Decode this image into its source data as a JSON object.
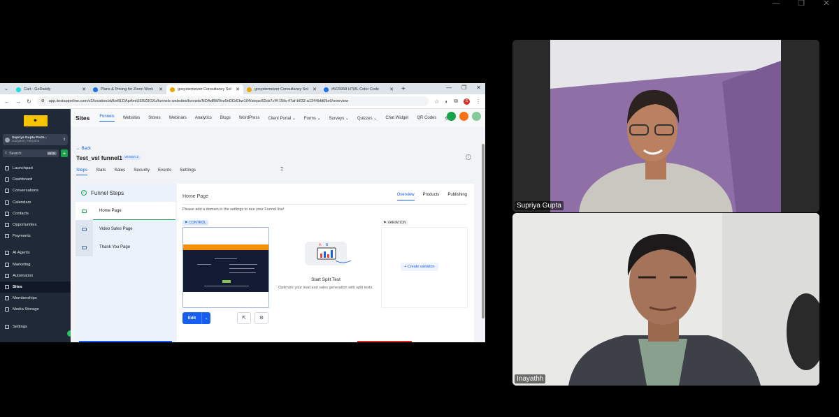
{
  "browser": {
    "tabs": [
      {
        "label": "Cart - GoDaddy",
        "icon": "godaddy-icon",
        "active": false
      },
      {
        "label": "Plans & Pricing for Zoom Work",
        "icon": "zoom-icon",
        "active": false
      },
      {
        "label": "gosystemeizer Consultancy Sol",
        "icon": "goosystemizer-icon",
        "active": true
      },
      {
        "label": "gosystemeizer Consultancy Sol",
        "icon": "goosystemizer-icon",
        "active": false
      },
      {
        "label": "#5C5958 HTML Color Code",
        "icon": "color-code-icon",
        "active": false
      }
    ],
    "url": "app.iinstapipeline.com/v2/location/aWzrBLDApAmiUEBZ0OZu/funnels-websites/funnels/NOAdBW9vz5nDGrEkw104/steps/62cb7cf4-15fa-47af-b632-a1344bfd69e9/overview",
    "profile_initial": "S"
  },
  "sidebar": {
    "account_name": "Supriya Gupta Profe...",
    "account_location": "Gurgaon, Haryana",
    "search_placeholder": "Search",
    "search_kbd": "ctrl K",
    "nav": [
      {
        "label": "Launchpad",
        "icon": "rocket-icon"
      },
      {
        "label": "Dashboard",
        "icon": "dashboard-icon"
      },
      {
        "label": "Conversations",
        "icon": "chat-icon"
      },
      {
        "label": "Calendars",
        "icon": "calendar-icon"
      },
      {
        "label": "Contacts",
        "icon": "contacts-icon"
      },
      {
        "label": "Opportunities",
        "icon": "opportunities-icon"
      },
      {
        "label": "Payments",
        "icon": "payments-icon"
      }
    ],
    "nav2": [
      {
        "label": "AI Agents",
        "icon": "ai-icon"
      },
      {
        "label": "Marketing",
        "icon": "marketing-icon"
      },
      {
        "label": "Automation",
        "icon": "automation-icon"
      },
      {
        "label": "Sites",
        "icon": "sites-icon",
        "active": true
      },
      {
        "label": "Memberships",
        "icon": "memberships-icon"
      },
      {
        "label": "Media Storage",
        "icon": "media-icon"
      }
    ],
    "settings_label": "Settings"
  },
  "topnav": {
    "brand": "Sites",
    "items": [
      "Funnels",
      "Websites",
      "Stores",
      "Webinars",
      "Analytics",
      "Blogs",
      "WordPress",
      "Client Portal",
      "Forms",
      "Surveys",
      "Quizzes",
      "Chat Widget",
      "QR Codes"
    ],
    "active": "Funnels"
  },
  "page": {
    "back": "← Back",
    "title": "Test_vsl funnel1",
    "version": "Version 2",
    "subtabs": [
      "Steps",
      "Stats",
      "Sales",
      "Security",
      "Events",
      "Settings"
    ],
    "active_subtab": "Steps"
  },
  "steps": {
    "header": "Funnel Steps",
    "items": [
      "Home Page",
      "Video Sales Page",
      "Thank You Page"
    ]
  },
  "panel": {
    "title": "Home Page",
    "tabs": [
      "Overview",
      "Products",
      "Publishing"
    ],
    "message": "Please add a domain in the settings to see your Funnel live!",
    "control_label": "CONTROL",
    "variation_label": "VARIATION",
    "edit_label": "Edit",
    "split_title": "Start Split Test",
    "split_desc": "Optimize your lead and sales generation with split tests.",
    "create_variation": "+ Create variation"
  },
  "participants": [
    {
      "name": "Supriya Gupta"
    },
    {
      "name": "Inayathh"
    }
  ],
  "colors": {
    "accent": "#155eef",
    "sidebar": "#1f2937",
    "success": "#22a35a"
  }
}
